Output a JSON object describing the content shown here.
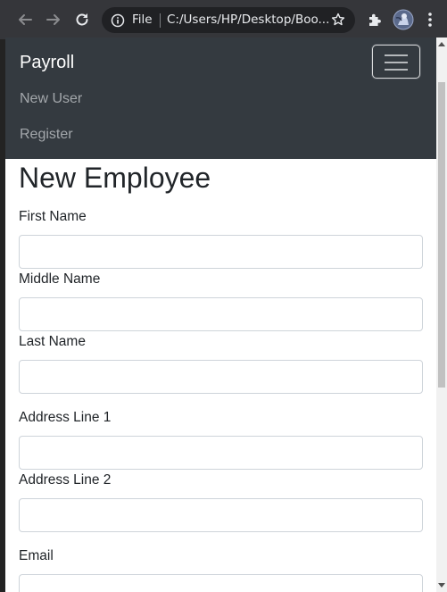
{
  "browser": {
    "scheme_label": "File",
    "url": "C:/Users/HP/Desktop/Boo..."
  },
  "navbar": {
    "brand": "Payroll",
    "links": [
      "New User",
      "Register"
    ],
    "bg_color": "#343a40"
  },
  "form": {
    "title": "New Employee",
    "fields": [
      {
        "label": "First Name",
        "value": ""
      },
      {
        "label": "Middle Name",
        "value": ""
      },
      {
        "label": "Last Name",
        "value": ""
      },
      {
        "label": "Address Line 1",
        "value": ""
      },
      {
        "label": "Address Line 2",
        "value": ""
      },
      {
        "label": "Email",
        "value": ""
      }
    ]
  }
}
